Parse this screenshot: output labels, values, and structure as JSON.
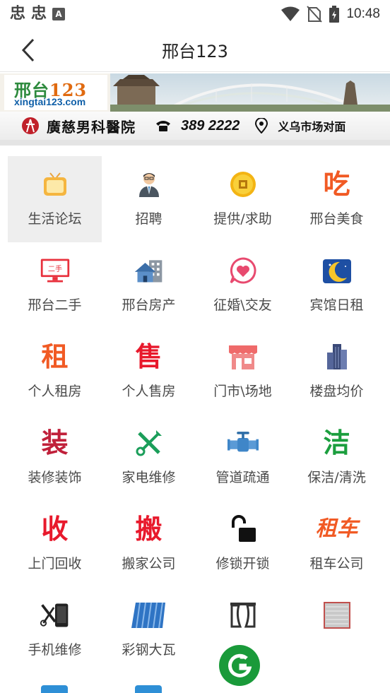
{
  "status_bar": {
    "left_glyphs": [
      "忠",
      "忠"
    ],
    "badge": "A",
    "time": "10:48"
  },
  "header": {
    "title": "邢台123"
  },
  "banner": {
    "logo_main_a": "邢台",
    "logo_main_b": "123",
    "logo_url": "xingtai123.com",
    "hospital": "廣慈男科醫院",
    "phone": "389 2222",
    "address": "义乌市场对面"
  },
  "grid": {
    "items": [
      {
        "label": "生活论坛",
        "icon": "tv-icon"
      },
      {
        "label": "招聘",
        "icon": "businessman-icon"
      },
      {
        "label": "提供/求助",
        "icon": "coin-icon"
      },
      {
        "label": "邢台美食",
        "icon": "eat-char-icon",
        "char": "吃",
        "color": "#f15a24"
      },
      {
        "label": "邢台二手",
        "icon": "monitor-secondhand-icon",
        "char": "二手"
      },
      {
        "label": "邢台房产",
        "icon": "building-house-icon"
      },
      {
        "label": "征婚\\交友",
        "icon": "heart-chat-icon"
      },
      {
        "label": "宾馆日租",
        "icon": "moon-icon"
      },
      {
        "label": "个人租房",
        "icon": "rent-char-icon",
        "char": "租",
        "color": "#f15a24"
      },
      {
        "label": "个人售房",
        "icon": "sell-char-icon",
        "char": "售",
        "color": "#e8192c"
      },
      {
        "label": "门市\\场地",
        "icon": "storefront-icon"
      },
      {
        "label": "楼盘均价",
        "icon": "skyscraper-icon"
      },
      {
        "label": "装修装饰",
        "icon": "decorate-char-icon",
        "char": "装",
        "color": "#c0203a"
      },
      {
        "label": "家电维修",
        "icon": "tools-icon"
      },
      {
        "label": "管道疏通",
        "icon": "pipe-valve-icon"
      },
      {
        "label": "保洁/清洗",
        "icon": "clean-char-icon",
        "char": "洁",
        "color": "#1b9e3e"
      },
      {
        "label": "上门回收",
        "icon": "recycle-char-icon",
        "char": "收",
        "color": "#e8192c"
      },
      {
        "label": "搬家公司",
        "icon": "move-char-icon",
        "char": "搬",
        "color": "#e8192c"
      },
      {
        "label": "修锁开锁",
        "icon": "unlock-icon"
      },
      {
        "label": "租车公司",
        "icon": "car-rent-char-icon",
        "char": "租车",
        "color": "#f15a24"
      },
      {
        "label": "手机维修",
        "icon": "phone-repair-icon"
      },
      {
        "label": "彩钢大瓦",
        "icon": "steel-tile-icon"
      },
      {
        "label": "",
        "icon": "curtain-icon"
      },
      {
        "label": "",
        "icon": "shutter-icon"
      }
    ]
  },
  "colors": {
    "active_bg": "#eeeeee",
    "brand_green": "#1a9a3a"
  }
}
